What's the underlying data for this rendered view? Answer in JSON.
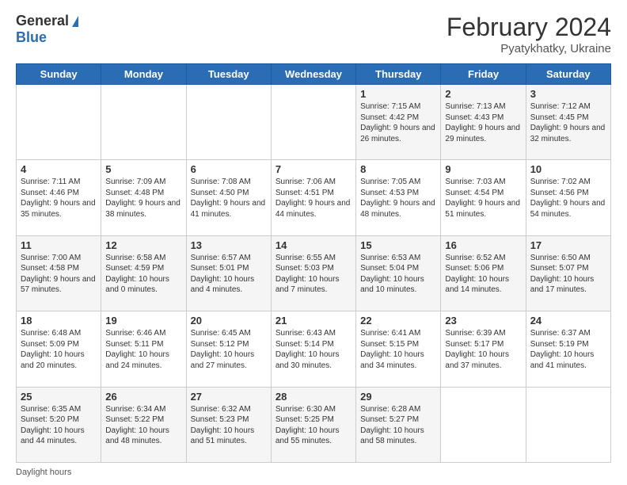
{
  "logo": {
    "general": "General",
    "blue": "Blue"
  },
  "header": {
    "month_year": "February 2024",
    "location": "Pyatykhatky, Ukraine"
  },
  "days_of_week": [
    "Sunday",
    "Monday",
    "Tuesday",
    "Wednesday",
    "Thursday",
    "Friday",
    "Saturday"
  ],
  "footer": {
    "daylight_hours_label": "Daylight hours"
  },
  "weeks": [
    {
      "days": [
        null,
        null,
        null,
        null,
        {
          "date": "1",
          "sunrise": "Sunrise: 7:15 AM",
          "sunset": "Sunset: 4:42 PM",
          "daylight": "Daylight: 9 hours and 26 minutes."
        },
        {
          "date": "2",
          "sunrise": "Sunrise: 7:13 AM",
          "sunset": "Sunset: 4:43 PM",
          "daylight": "Daylight: 9 hours and 29 minutes."
        },
        {
          "date": "3",
          "sunrise": "Sunrise: 7:12 AM",
          "sunset": "Sunset: 4:45 PM",
          "daylight": "Daylight: 9 hours and 32 minutes."
        }
      ]
    },
    {
      "days": [
        {
          "date": "4",
          "sunrise": "Sunrise: 7:11 AM",
          "sunset": "Sunset: 4:46 PM",
          "daylight": "Daylight: 9 hours and 35 minutes."
        },
        {
          "date": "5",
          "sunrise": "Sunrise: 7:09 AM",
          "sunset": "Sunset: 4:48 PM",
          "daylight": "Daylight: 9 hours and 38 minutes."
        },
        {
          "date": "6",
          "sunrise": "Sunrise: 7:08 AM",
          "sunset": "Sunset: 4:50 PM",
          "daylight": "Daylight: 9 hours and 41 minutes."
        },
        {
          "date": "7",
          "sunrise": "Sunrise: 7:06 AM",
          "sunset": "Sunset: 4:51 PM",
          "daylight": "Daylight: 9 hours and 44 minutes."
        },
        {
          "date": "8",
          "sunrise": "Sunrise: 7:05 AM",
          "sunset": "Sunset: 4:53 PM",
          "daylight": "Daylight: 9 hours and 48 minutes."
        },
        {
          "date": "9",
          "sunrise": "Sunrise: 7:03 AM",
          "sunset": "Sunset: 4:54 PM",
          "daylight": "Daylight: 9 hours and 51 minutes."
        },
        {
          "date": "10",
          "sunrise": "Sunrise: 7:02 AM",
          "sunset": "Sunset: 4:56 PM",
          "daylight": "Daylight: 9 hours and 54 minutes."
        }
      ]
    },
    {
      "days": [
        {
          "date": "11",
          "sunrise": "Sunrise: 7:00 AM",
          "sunset": "Sunset: 4:58 PM",
          "daylight": "Daylight: 9 hours and 57 minutes."
        },
        {
          "date": "12",
          "sunrise": "Sunrise: 6:58 AM",
          "sunset": "Sunset: 4:59 PM",
          "daylight": "Daylight: 10 hours and 0 minutes."
        },
        {
          "date": "13",
          "sunrise": "Sunrise: 6:57 AM",
          "sunset": "Sunset: 5:01 PM",
          "daylight": "Daylight: 10 hours and 4 minutes."
        },
        {
          "date": "14",
          "sunrise": "Sunrise: 6:55 AM",
          "sunset": "Sunset: 5:03 PM",
          "daylight": "Daylight: 10 hours and 7 minutes."
        },
        {
          "date": "15",
          "sunrise": "Sunrise: 6:53 AM",
          "sunset": "Sunset: 5:04 PM",
          "daylight": "Daylight: 10 hours and 10 minutes."
        },
        {
          "date": "16",
          "sunrise": "Sunrise: 6:52 AM",
          "sunset": "Sunset: 5:06 PM",
          "daylight": "Daylight: 10 hours and 14 minutes."
        },
        {
          "date": "17",
          "sunrise": "Sunrise: 6:50 AM",
          "sunset": "Sunset: 5:07 PM",
          "daylight": "Daylight: 10 hours and 17 minutes."
        }
      ]
    },
    {
      "days": [
        {
          "date": "18",
          "sunrise": "Sunrise: 6:48 AM",
          "sunset": "Sunset: 5:09 PM",
          "daylight": "Daylight: 10 hours and 20 minutes."
        },
        {
          "date": "19",
          "sunrise": "Sunrise: 6:46 AM",
          "sunset": "Sunset: 5:11 PM",
          "daylight": "Daylight: 10 hours and 24 minutes."
        },
        {
          "date": "20",
          "sunrise": "Sunrise: 6:45 AM",
          "sunset": "Sunset: 5:12 PM",
          "daylight": "Daylight: 10 hours and 27 minutes."
        },
        {
          "date": "21",
          "sunrise": "Sunrise: 6:43 AM",
          "sunset": "Sunset: 5:14 PM",
          "daylight": "Daylight: 10 hours and 30 minutes."
        },
        {
          "date": "22",
          "sunrise": "Sunrise: 6:41 AM",
          "sunset": "Sunset: 5:15 PM",
          "daylight": "Daylight: 10 hours and 34 minutes."
        },
        {
          "date": "23",
          "sunrise": "Sunrise: 6:39 AM",
          "sunset": "Sunset: 5:17 PM",
          "daylight": "Daylight: 10 hours and 37 minutes."
        },
        {
          "date": "24",
          "sunrise": "Sunrise: 6:37 AM",
          "sunset": "Sunset: 5:19 PM",
          "daylight": "Daylight: 10 hours and 41 minutes."
        }
      ]
    },
    {
      "days": [
        {
          "date": "25",
          "sunrise": "Sunrise: 6:35 AM",
          "sunset": "Sunset: 5:20 PM",
          "daylight": "Daylight: 10 hours and 44 minutes."
        },
        {
          "date": "26",
          "sunrise": "Sunrise: 6:34 AM",
          "sunset": "Sunset: 5:22 PM",
          "daylight": "Daylight: 10 hours and 48 minutes."
        },
        {
          "date": "27",
          "sunrise": "Sunrise: 6:32 AM",
          "sunset": "Sunset: 5:23 PM",
          "daylight": "Daylight: 10 hours and 51 minutes."
        },
        {
          "date": "28",
          "sunrise": "Sunrise: 6:30 AM",
          "sunset": "Sunset: 5:25 PM",
          "daylight": "Daylight: 10 hours and 55 minutes."
        },
        {
          "date": "29",
          "sunrise": "Sunrise: 6:28 AM",
          "sunset": "Sunset: 5:27 PM",
          "daylight": "Daylight: 10 hours and 58 minutes."
        },
        null,
        null
      ]
    }
  ]
}
